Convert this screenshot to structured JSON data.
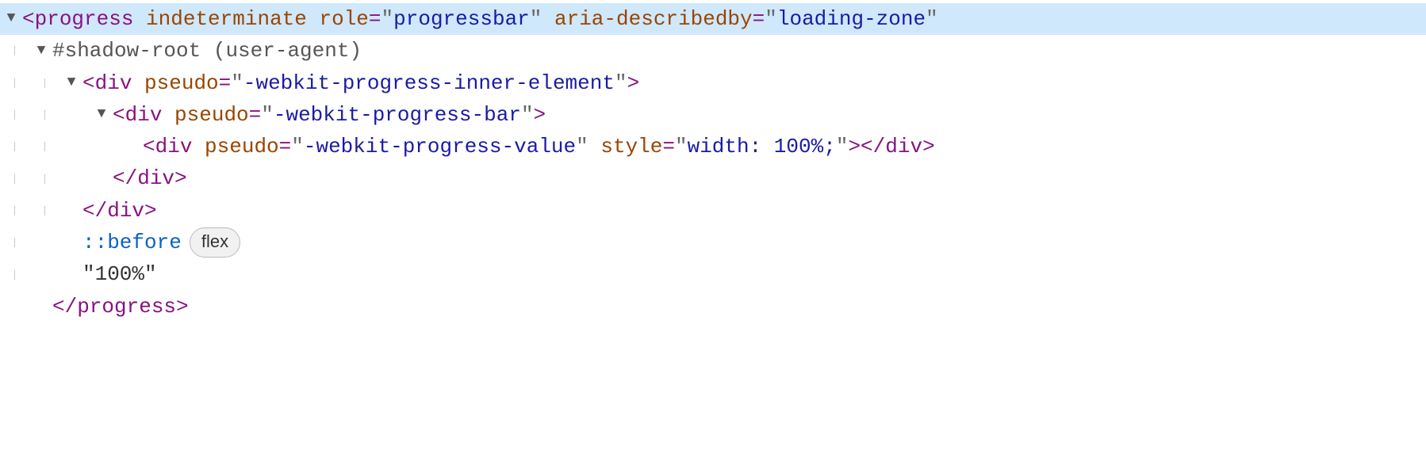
{
  "tree": {
    "line1": {
      "tag": "progress",
      "attr1_name": "indeterminate",
      "attr2_name": "role",
      "attr2_val": "progressbar",
      "attr3_name": "aria-describedby",
      "attr3_val": "loading-zone"
    },
    "line2": {
      "shadow_label": "#shadow-root",
      "shadow_kind": "(user-agent)"
    },
    "line3": {
      "tag": "div",
      "attr1_name": "pseudo",
      "attr1_val": "-webkit-progress-inner-element"
    },
    "line4": {
      "tag": "div",
      "attr1_name": "pseudo",
      "attr1_val": "-webkit-progress-bar"
    },
    "line5": {
      "tag": "div",
      "attr1_name": "pseudo",
      "attr1_val": "-webkit-progress-value",
      "attr2_name": "style",
      "attr2_val": "width: 100%;",
      "close_tag": "div"
    },
    "line6": {
      "close_tag": "div"
    },
    "line7": {
      "close_tag": "div"
    },
    "line8": {
      "pseudo": "::before",
      "badge": "flex"
    },
    "line9": {
      "text": "\"100%\""
    },
    "line10": {
      "close_tag": "progress"
    }
  },
  "glyphs": {
    "expanded": "▼"
  }
}
